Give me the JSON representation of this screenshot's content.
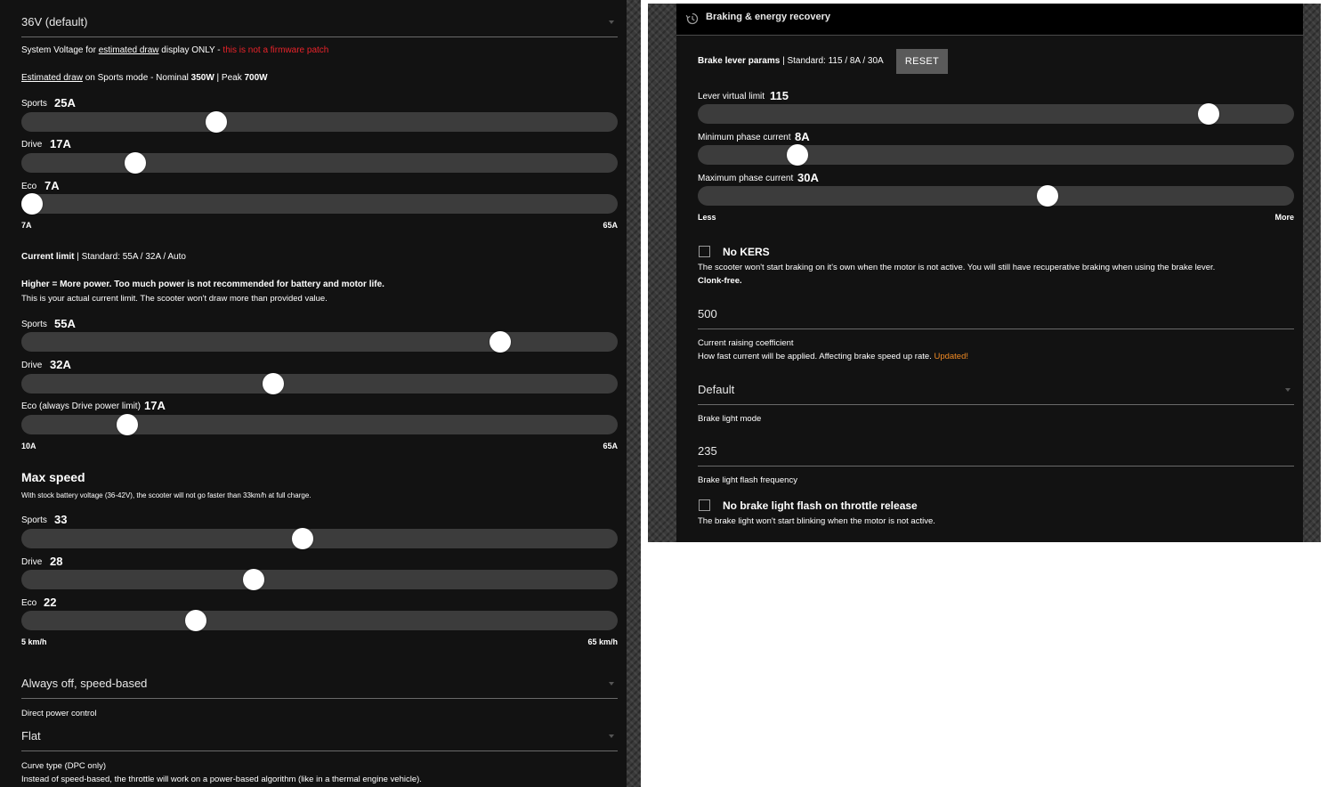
{
  "left": {
    "voltage_select": {
      "value": "36V (default)"
    },
    "voltage_note": {
      "pre": "System Voltage for ",
      "link": "estimated draw",
      "mid": " display ONLY - ",
      "warning": "this is not a firmware patch"
    },
    "draw_note": {
      "link": "Estimated draw",
      "text1": " on Sports mode - Nominal ",
      "nominal": "350W",
      "text2": " | Peak ",
      "peak": "700W"
    },
    "power_sliders": [
      {
        "label": "Sports",
        "value": "25A",
        "fraction": 0.32
      },
      {
        "label": "Drive",
        "value": "17A",
        "fraction": 0.18
      },
      {
        "label": "Eco",
        "value": "7A",
        "fraction": 0.0
      }
    ],
    "power_range": {
      "min": "7A",
      "max": "65A"
    },
    "current_limit": {
      "title": "Current limit",
      "standard": " | Standard: 55A / 32A / Auto",
      "bold_line": "Higher = More power. Too much power is not recommended for battery and motor life.",
      "line": "This is your actual current limit. The scooter won't draw more than provided value."
    },
    "current_sliders": [
      {
        "label": "Sports",
        "value": "55A",
        "fraction": 0.815
      },
      {
        "label": "Drive",
        "value": "32A",
        "fraction": 0.42
      },
      {
        "label": "Eco (always Drive power limit)",
        "value": "17A",
        "fraction": 0.165
      }
    ],
    "current_range": {
      "min": "10A",
      "max": "65A"
    },
    "max_speed": {
      "title": "Max speed",
      "note": "With stock battery voltage (36-42V), the scooter will not go faster than 33km/h at full charge."
    },
    "speed_sliders": [
      {
        "label": "Sports",
        "value": "33",
        "fraction": 0.47
      },
      {
        "label": "Drive",
        "value": "28",
        "fraction": 0.385
      },
      {
        "label": "Eco",
        "value": "22",
        "fraction": 0.285
      }
    ],
    "speed_range": {
      "min": "5 km/h",
      "max": "65 km/h"
    },
    "dpc_select": {
      "value": "Always off, speed-based",
      "label": "Direct power control"
    },
    "curve_select": {
      "value": "Flat",
      "label": "Curve type (DPC only)",
      "note": "Instead of speed-based, the throttle will work on a power-based algorithm (like in a thermal engine vehicle)."
    }
  },
  "right": {
    "header_title": "Braking & energy recovery",
    "brake_params": {
      "title": "Brake lever params",
      "standard": " | Standard: 115 / 8A / 30A",
      "reset_label": "RESET"
    },
    "brake_sliders": [
      {
        "label": "Lever virtual limit",
        "value": "115",
        "fraction": 0.87
      },
      {
        "label": "Minimum phase current",
        "value": "8A",
        "fraction": 0.155
      },
      {
        "label": "Maximum phase current",
        "value": "30A",
        "fraction": 0.59
      }
    ],
    "brake_range": {
      "min": "Less",
      "max": "More"
    },
    "no_kers": {
      "title": "No KERS",
      "desc": "The scooter won't start braking on it's own when the motor is not active. You will still have recuperative braking when using the brake lever.",
      "bold": "Clonk-free."
    },
    "raising_coeff": {
      "value": "500",
      "label": "Current raising coefficient",
      "desc": "How fast current will be applied. Affecting brake speed up rate. ",
      "updated": "Updated!"
    },
    "brake_light_mode": {
      "value": "Default",
      "label": "Brake light mode"
    },
    "flash_freq": {
      "value": "235",
      "label": "Brake light flash frequency"
    },
    "no_flash": {
      "title": "No brake light flash on throttle release",
      "desc": "The brake light won't start blinking when the motor is not active."
    }
  },
  "colors": {
    "panel_bg": "#121212",
    "track": "#3c3c3c",
    "thumb": "#ffffff",
    "warning": "#e8232a",
    "updated": "#f08a24",
    "button": "#5a5a5a"
  },
  "icons": {
    "header": "history-icon",
    "select": "chevron-down-icon"
  }
}
